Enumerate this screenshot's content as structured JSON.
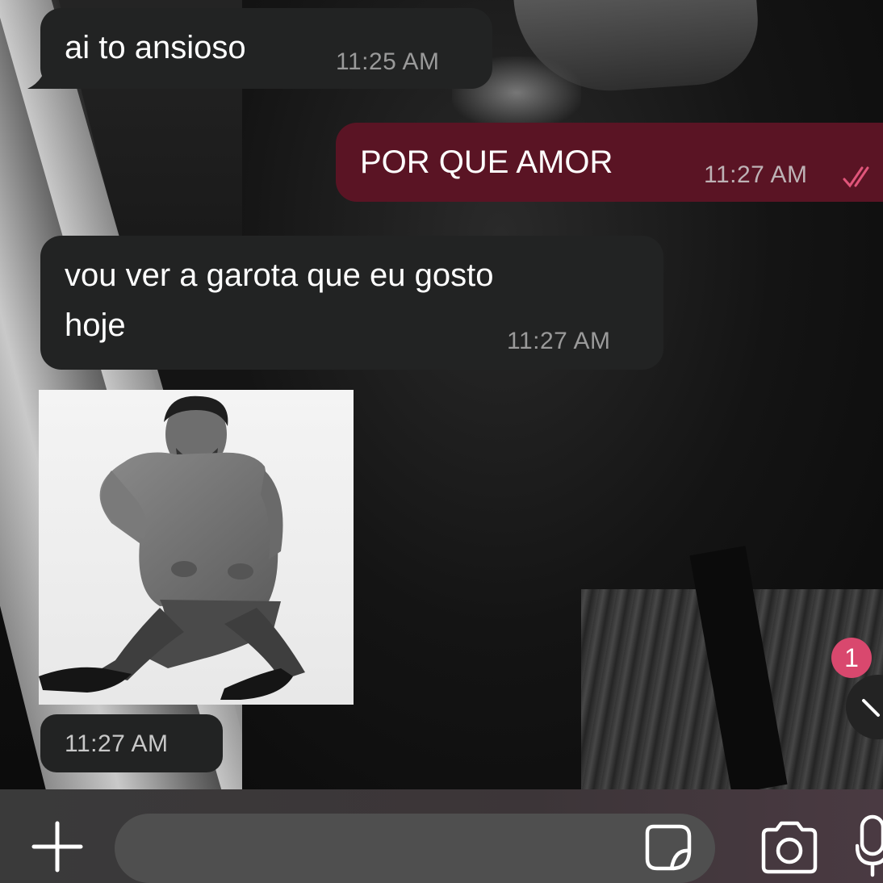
{
  "messages": [
    {
      "direction": "incoming",
      "text": "ai to ansioso",
      "time": "11:25 AM"
    },
    {
      "direction": "outgoing",
      "text": "POR QUE AMOR",
      "time": "11:27 AM",
      "status": "read"
    },
    {
      "direction": "incoming",
      "text": "vou ver a garota que eu gosto\nhoje",
      "time": "11:27 AM"
    },
    {
      "direction": "incoming",
      "type": "photo",
      "time": "11:27 AM"
    }
  ],
  "scroll_button": {
    "unread_count": "1"
  },
  "composer": {
    "placeholder": "",
    "value": ""
  },
  "icons": {
    "attach": "plus-icon",
    "sticker": "sticker-icon",
    "camera": "camera-icon",
    "mic": "microphone-icon",
    "scroll": "chevron-down-icon",
    "read": "double-check-icon"
  },
  "colors": {
    "incoming_bubble": "#222323",
    "outgoing_bubble": "#5a1424",
    "read_ticks": "#e0557a",
    "badge": "#d9486e"
  }
}
